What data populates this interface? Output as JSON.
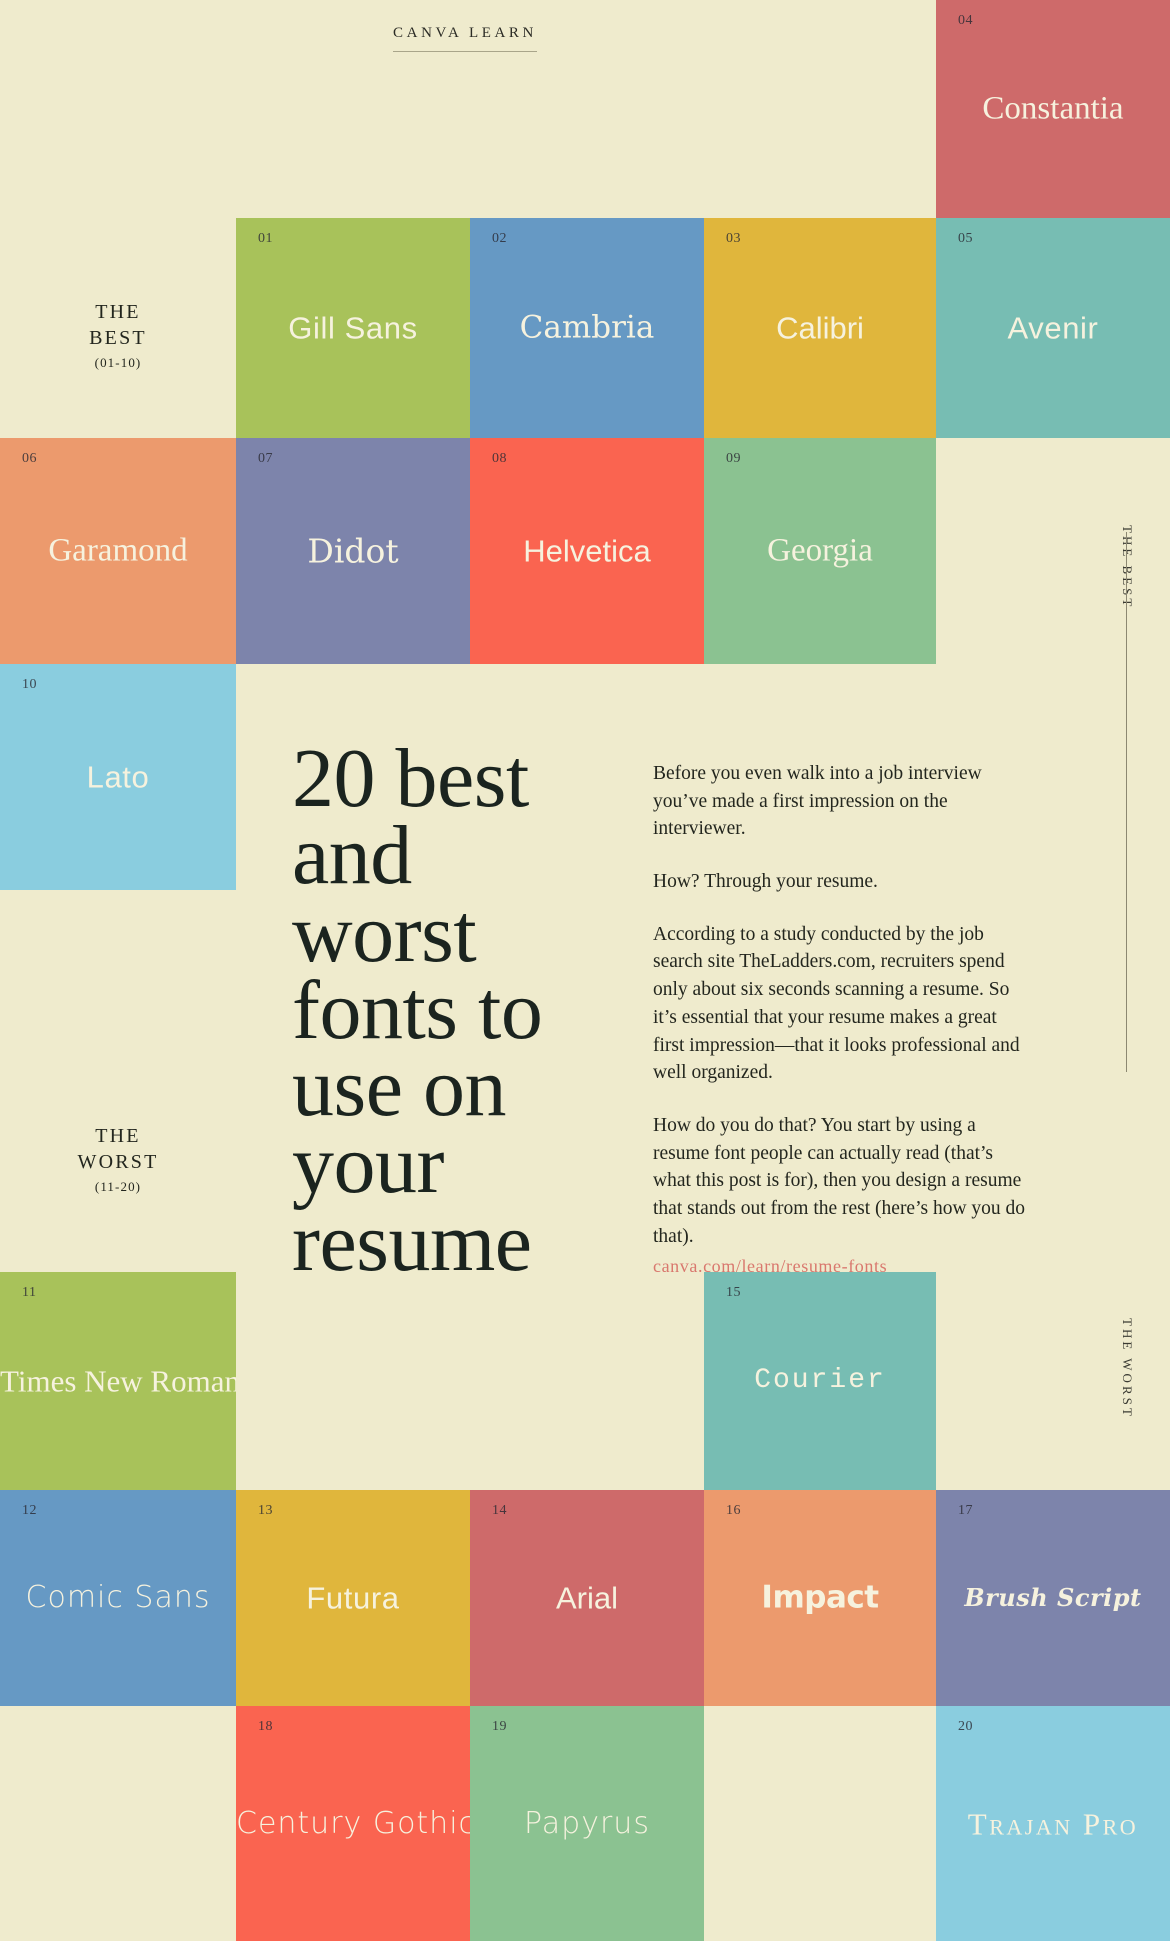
{
  "header": {
    "brand": "CANVA LEARN"
  },
  "sections": {
    "best": {
      "line1": "THE\nBEST",
      "title_l1": "THE",
      "title_l2": "BEST",
      "range": "(01-10)"
    },
    "worst": {
      "title_l1": "THE",
      "title_l2": "WORST",
      "range": "(11-20)"
    },
    "rail_best": "THE BEST",
    "rail_worst": "THE WORST"
  },
  "headline": "20 best and worst fonts to use on your resume",
  "body": {
    "p1": "Before you even walk into a job interview you’ve made a first impression on the interviewer.",
    "p2": "How? Through your resume.",
    "p3": "According to a study conducted by the job search site TheLadders.com, recruiters spend only about six seconds scanning a resume. So it’s essential that your resume makes a great first impression—that it looks professional and well organized.",
    "p4": "How do you do that? You start by using a resume font people can actually read (that’s what this post is for), then you design a resume that stands out from the rest (here’s how you do that).",
    "url": "canva.com/learn/resume-fonts"
  },
  "colors": {
    "background": "#EFEBCD",
    "ink": "#1D2621",
    "tile_text": "#F6F2DE",
    "link": "#D9786E",
    "rule": "#A9A58A",
    "green": "#A8C25A",
    "blue": "#6699C4",
    "gold": "#E0B63C",
    "red": "#CE6A6A",
    "teal": "#77BDB3",
    "orange": "#EC9A6D",
    "slate": "#7D84AB",
    "coral": "#FA6450",
    "sage": "#8BC291",
    "skyblue": "#8ACDDF"
  },
  "tiles": [
    {
      "num": "01",
      "name": "Gill Sans",
      "color": "#A8C25A",
      "style": "f-sans-l",
      "size": 31
    },
    {
      "num": "02",
      "name": "Cambria",
      "color": "#6699C4",
      "style": "f-serif-d",
      "size": 31
    },
    {
      "num": "03",
      "name": "Calibri",
      "color": "#E0B63C",
      "style": "f-sans",
      "size": 31
    },
    {
      "num": "04",
      "name": "Constantia",
      "color": "#CE6A6A",
      "style": "f-serif",
      "size": 33
    },
    {
      "num": "05",
      "name": "Avenir",
      "color": "#77BDB3",
      "style": "f-sans-l",
      "size": 31
    },
    {
      "num": "06",
      "name": "Garamond",
      "color": "#EC9A6D",
      "style": "f-serif",
      "size": 33
    },
    {
      "num": "07",
      "name": "Didot",
      "color": "#7D84AB",
      "style": "f-serif-d",
      "size": 33
    },
    {
      "num": "08",
      "name": "Helvetica",
      "color": "#FA6450",
      "style": "f-sans",
      "size": 31
    },
    {
      "num": "09",
      "name": "Georgia",
      "color": "#8BC291",
      "style": "f-serif",
      "size": 33
    },
    {
      "num": "10",
      "name": "Lato",
      "color": "#8ACDDF",
      "style": "f-sans-l",
      "size": 31
    },
    {
      "num": "11",
      "name": "Times New Roman",
      "color": "#A8C25A",
      "style": "f-serif",
      "size": 31
    },
    {
      "num": "12",
      "name": "Comic Sans",
      "color": "#6699C4",
      "style": "f-round",
      "size": 30
    },
    {
      "num": "13",
      "name": "Futura",
      "color": "#E0B63C",
      "style": "f-sans-l",
      "size": 31
    },
    {
      "num": "14",
      "name": "Arial",
      "color": "#CE6A6A",
      "style": "f-sans",
      "size": 31
    },
    {
      "num": "15",
      "name": "Courier",
      "color": "#77BDB3",
      "style": "f-mono",
      "size": 28
    },
    {
      "num": "16",
      "name": "Impact",
      "color": "#EC9A6D",
      "style": "f-impact",
      "size": 31
    },
    {
      "num": "17",
      "name": "Brush Script",
      "color": "#7D84AB",
      "style": "f-script",
      "size": 24
    },
    {
      "num": "18",
      "name": "Century Gothic",
      "color": "#FA6450",
      "style": "f-round",
      "size": 30
    },
    {
      "num": "19",
      "name": "Papyrus",
      "color": "#8BC291",
      "style": "f-round",
      "size": 30
    },
    {
      "num": "20",
      "name": "Trajan Pro",
      "color": "#8ACDDF",
      "style": "f-caps",
      "size": 31
    }
  ]
}
